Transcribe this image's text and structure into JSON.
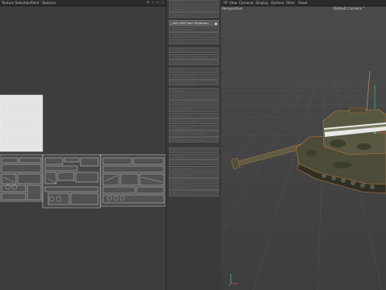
{
  "uv_editor": {
    "menu": [
      "Texture Selection",
      "Paint",
      "Textures"
    ]
  },
  "command_palette": {
    "groups": [
      [
        {
          "label": "UV Fit"
        },
        {
          "label": "Relocate UVs Only"
        },
        {
          "label": "Realign UV"
        }
      ],
      [
        {
          "label": "Set UVW From Projection",
          "active": true
        },
        {
          "label": "UV Transform"
        },
        {
          "label": "UV Island Overview"
        },
        {
          "label": "UV Peeler"
        }
      ],
      [
        {
          "label": "UV Pixels"
        },
        {
          "label": "Scale UV to Shrinkwrap"
        },
        {
          "label": "Scale Island to Shrinkwrap"
        }
      ],
      [
        {
          "label": "Flip UV"
        },
        {
          "label": "UV Fit to Canvas"
        },
        {
          "label": "Fit UV to Canvas"
        }
      ],
      [
        {
          "label": "Mirror U"
        },
        {
          "label": "Mirror V"
        },
        {
          "label": "Flip UV CW"
        },
        {
          "label": "Flip UV CCW"
        },
        {
          "label": "UV Straighten"
        },
        {
          "label": "Align Horizontally"
        },
        {
          "label": "Straighten UV"
        },
        {
          "label": "Straighten U Selected"
        },
        {
          "label": "Straighten V Selected"
        }
      ],
      [
        {
          "label": "Snap UV"
        },
        {
          "label": "Grid UV"
        },
        {
          "label": "Layout UV Selected"
        },
        {
          "label": "Layout All UV"
        },
        {
          "label": "UV Sequence"
        },
        {
          "label": "Pack UV"
        },
        {
          "label": "Optimize UV"
        },
        {
          "label": "Relax UV"
        }
      ]
    ]
  },
  "viewport": {
    "menu": [
      "View",
      "Cameras",
      "Display",
      "Options",
      "Filter",
      "Panel"
    ],
    "projection_label": "Perspective",
    "camera_label": "Default Camera °"
  }
}
